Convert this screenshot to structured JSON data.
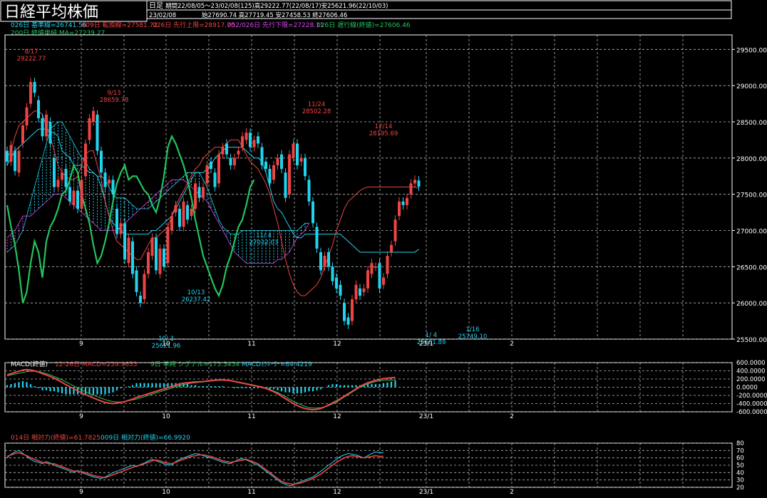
{
  "header": {
    "title": "日経平均株価",
    "period_type": "日足",
    "period_info": "期間22/08/05～23/02/08(125)高29222.77(22/08/17)安25621.96(22/10/03)",
    "date": "23/02/08",
    "ohlc": "始27690.74 高27719.45 安27458.53 終27606.46"
  },
  "legend_line1": [
    {
      "text": "026日 基準線=26741.56",
      "color": "#22d3ee"
    },
    {
      "text": "009日 転換線=27581.72",
      "color": "#ef4444"
    },
    {
      "text": "026日 先行上限=28917.70",
      "color": "#ef4444"
    },
    {
      "text": "052/026日 先行下限=27228.11",
      "color": "#d946ef"
    },
    {
      "text": "026日 遅行線(終値)=27606.46",
      "color": "#22c55e"
    }
  ],
  "legend_line2": [
    {
      "text": "200日 終値単純 MA=27239.27",
      "color": "#22c55e"
    }
  ],
  "macd_legend": [
    {
      "text": "MACD(終値)",
      "color": "#ffffff"
    },
    {
      "text": "12-26日 MACD=239.9653",
      "color": "#ef4444"
    },
    {
      "text": "9日 単純 シグナル=175.5434",
      "color": "#22c55e"
    },
    {
      "text": "MACDｵｼﾚｰﾀｰ=64.4219",
      "color": "#22d3ee"
    }
  ],
  "rsi_legend": [
    {
      "text": "014日 相対力(終値)=61.7825",
      "color": "#ef4444"
    },
    {
      "text": "009日 相対力(終値)=66.9920",
      "color": "#22d3ee"
    }
  ],
  "month_labels": [
    "9",
    "10",
    "11",
    "12",
    "23/1",
    "2"
  ],
  "colors": {
    "up": "#ef4444",
    "down": "#22d3ee",
    "cloud_a": "#22d3ee",
    "cloud_b": "#d946ef",
    "lagging": "#22c55e",
    "grid": "#bbbbbb"
  },
  "chart_data": [
    {
      "type": "candlestick",
      "ylim": [
        25500,
        29700
      ],
      "yticks": [
        "29500.00",
        "29000.00",
        "28500.00",
        "28000.00",
        "27500.00",
        "27000.00",
        "26500.00",
        "26000.00",
        "25500.00"
      ],
      "annotations": [
        {
          "label": "8/17",
          "value": "29222.77",
          "color": "#ef4444"
        },
        {
          "label": "9/13",
          "value": "28659.78",
          "color": "#ef4444"
        },
        {
          "label": "10/ 3",
          "value": "25621.96",
          "color": "#22d3ee"
        },
        {
          "label": "10/13",
          "value": "26237.42",
          "color": "#22d3ee"
        },
        {
          "label": "11/ 4",
          "value": "27032.03",
          "color": "#22d3ee"
        },
        {
          "label": "11/24",
          "value": "28502.28",
          "color": "#ef4444"
        },
        {
          "label": "12/14",
          "value": "28195.69",
          "color": "#ef4444"
        },
        {
          "label": "1/ 4",
          "value": "25661.89",
          "color": "#22d3ee"
        },
        {
          "label": "1/16",
          "value": "25749.10",
          "color": "#22d3ee"
        }
      ],
      "closes": [
        27950,
        28180,
        27820,
        28100,
        28450,
        28700,
        29050,
        28900,
        28550,
        28300,
        28600,
        28200,
        27600,
        27700,
        27800,
        27600,
        27400,
        27550,
        27300,
        27700,
        28200,
        28550,
        28650,
        28100,
        27800,
        27600,
        27700,
        27500,
        26950,
        27100,
        26600,
        26900,
        26400,
        26150,
        26000,
        26400,
        26700,
        26900,
        26450,
        26750,
        26500,
        27050,
        27200,
        27350,
        27050,
        27400,
        27150,
        27300,
        27650,
        27450,
        27600,
        27900,
        27850,
        27600,
        28050,
        28150,
        28050,
        27900,
        28000,
        28100,
        28300,
        28350,
        28150,
        28250,
        28200,
        27900,
        27850,
        27650,
        27900,
        28000,
        27850,
        27450,
        28050,
        28200,
        27900,
        28000,
        27750,
        27400,
        27100,
        26750,
        26450,
        26650,
        26500,
        26300,
        26200,
        26100,
        25750,
        25700,
        26050,
        26250,
        26100,
        26200,
        26450,
        26550,
        26500,
        26200,
        26350,
        26650,
        26800,
        27150,
        27400,
        27350,
        27450,
        27650,
        27700,
        27606
      ],
      "opens": [
        28100,
        27950,
        28100,
        27800,
        28200,
        28450,
        28750,
        29050,
        28800,
        28550,
        28300,
        28500,
        28000,
        27600,
        27700,
        27850,
        27600,
        27350,
        27550,
        27300,
        27750,
        28250,
        28500,
        28600,
        28100,
        27800,
        27650,
        27700,
        27300,
        26950,
        27100,
        26550,
        26850,
        26450,
        26100,
        26050,
        26400,
        26650,
        26900,
        26400,
        26750,
        26550,
        27000,
        27250,
        27300,
        27050,
        27350,
        27200,
        27300,
        27600,
        27450,
        27650,
        27950,
        27800,
        27650,
        28050,
        28200,
        28000,
        27900,
        28050,
        28150,
        28250,
        28350,
        28150,
        28300,
        28150,
        27950,
        27850,
        27700,
        27900,
        28050,
        27800,
        27500,
        28000,
        28200,
        27950,
        28000,
        27700,
        27400,
        27050,
        26700,
        26500,
        26700,
        26500,
        26350,
        26250,
        26000,
        25800,
        25750,
        26050,
        26200,
        26150,
        26200,
        26400,
        26500,
        26550,
        26250,
        26400,
        26700,
        26850,
        27200,
        27400,
        27350,
        27500,
        27650,
        27690
      ],
      "kijun": [
        27900,
        28000,
        28100,
        28150,
        28200,
        28250,
        28300,
        28350,
        28400,
        28400,
        28400,
        28350,
        28350,
        28300,
        28100,
        28050,
        28000,
        27900,
        27900,
        27900,
        27850,
        27800,
        27800,
        27750,
        27600,
        27400,
        27200,
        27100,
        27050,
        27000,
        26950,
        26950,
        26950,
        26950,
        26950,
        26950,
        26950,
        27000,
        27000,
        27050,
        27100,
        27150,
        27200,
        27300,
        27400,
        27500,
        27600,
        27700,
        27800,
        27800,
        27800,
        27850,
        27900,
        28000,
        28050,
        28100,
        28150,
        28150,
        28150,
        28150,
        28150,
        28100,
        28050,
        28000,
        28000,
        27950,
        27800,
        27600,
        27400,
        27300,
        27250,
        27150,
        27050,
        26950,
        26900,
        26900,
        26950,
        26950,
        26950,
        26950,
        26950,
        26950,
        26950,
        26950,
        26950,
        26950,
        26900,
        26850,
        26800,
        26750,
        26700,
        26700,
        26700,
        26700,
        26700,
        26700,
        26700,
        26700,
        26700,
        26700,
        26700,
        26700,
        26700,
        26700,
        26700,
        26742
      ],
      "tenkan": [
        28000,
        28100,
        28300,
        28450,
        28500,
        28550,
        28600,
        28650,
        28650,
        28600,
        28450,
        28300,
        28100,
        27900,
        27800,
        27750,
        27700,
        27700,
        27750,
        27900,
        28050,
        28100,
        28100,
        27900,
        27700,
        27400,
        27200,
        27000,
        26850,
        26800,
        26750,
        26700,
        26650,
        26600,
        26600,
        26700,
        26800,
        26900,
        26900,
        26950,
        27000,
        27050,
        27200,
        27350,
        27450,
        27550,
        27650,
        27750,
        27850,
        27900,
        28000,
        28050,
        28100,
        28150,
        28150,
        28150,
        28200,
        28250,
        28250,
        28250,
        28150,
        28050,
        27950,
        27900,
        27850,
        27750,
        27650,
        27500,
        27300,
        27100,
        26850,
        26600,
        26400,
        26250,
        26150,
        26100,
        26100,
        26150,
        26200,
        26250,
        26350,
        26500,
        26650,
        26800,
        27000,
        27150,
        27300,
        27400,
        27450,
        27500,
        27550,
        27582,
        27600,
        27600,
        27600,
        27600,
        27600,
        27600,
        27600,
        27600,
        27600,
        27600,
        27600,
        27600,
        27600,
        27582
      ],
      "lagging": [
        27350,
        27050,
        26800,
        26450,
        26000,
        26150,
        26550,
        26850,
        26700,
        26350,
        26850,
        27050,
        27150,
        27300,
        27500,
        27550,
        27700,
        27900,
        27800,
        27500,
        27300,
        27100,
        26800,
        26550,
        26650,
        26850,
        27100,
        27400,
        27650,
        27800,
        27900,
        27700,
        27750,
        27750,
        27650,
        27550,
        27500,
        27350,
        27250,
        27450,
        27750,
        28150,
        28300,
        28200,
        28050,
        27900,
        27700,
        27450,
        27150,
        26900,
        26650,
        26500,
        26350,
        26200,
        26100,
        26250,
        26500,
        26650,
        26850,
        27050,
        27150,
        27350,
        27600,
        27700
      ],
      "cloud_a": [
        26700,
        26750,
        26800,
        26900,
        27000,
        27200,
        27400,
        27600,
        27800,
        28000,
        28200,
        28400,
        28450,
        28500,
        28500,
        28400,
        28300,
        28200,
        28100,
        28000,
        27950,
        27850,
        27800,
        27750,
        27750,
        27700,
        27600,
        27500,
        27450,
        27450,
        27450,
        27400,
        27350,
        27300,
        27300,
        27300,
        27300,
        27350,
        27400,
        27450,
        27500,
        27550,
        27600,
        27650,
        27700,
        27750,
        27800,
        27800,
        27800,
        27800,
        27700,
        27600,
        27450,
        27300,
        27150,
        27050,
        27000,
        26950,
        26950,
        26950,
        27000,
        27000,
        27000,
        27000,
        27000,
        27000,
        27000,
        27000,
        27000,
        27000,
        27000,
        27000,
        27000,
        27000,
        27000,
        27050,
        27100,
        27100
      ],
      "cloud_b": [
        26900,
        26950,
        27000,
        27100,
        27200,
        27200,
        27200,
        27250,
        27300,
        27350,
        27400,
        27450,
        27500,
        27500,
        27500,
        27450,
        27400,
        27350,
        27300,
        27250,
        27200,
        27150,
        27100,
        27050,
        27000,
        27000,
        27000,
        27000,
        27000,
        27050,
        27100,
        27150,
        27200,
        27250,
        27300,
        27350,
        27400,
        27450,
        27500,
        27550,
        27600,
        27650,
        27700,
        27700,
        27700,
        27700,
        27650,
        27600,
        27550,
        27500,
        27450,
        27400,
        27300,
        27200,
        27100,
        27000,
        26900,
        26800,
        26700,
        26650,
        26600,
        26550,
        26550,
        26550,
        26550,
        26550,
        26550,
        26550,
        26550,
        26600,
        26600,
        26650,
        26700,
        26800,
        26900,
        26950,
        27000,
        27100
      ]
    },
    {
      "type": "line",
      "name": "MACD",
      "ylim": [
        -600000,
        600000
      ],
      "yticks": [
        "600.0000",
        "400.0000",
        "200.0000",
        "0.0000",
        "-200.0000",
        "-400.0000",
        "-600.0000"
      ],
      "macd": [
        300,
        330,
        360,
        390,
        420,
        430,
        420,
        400,
        370,
        330,
        300,
        260,
        220,
        170,
        120,
        60,
        10,
        -40,
        -90,
        -140,
        -180,
        -220,
        -260,
        -300,
        -340,
        -370,
        -390,
        -400,
        -390,
        -370,
        -350,
        -320,
        -290,
        -250,
        -220,
        -190,
        -160,
        -130,
        -100,
        -70,
        -40,
        -10,
        20,
        50,
        80,
        100,
        110,
        120,
        130,
        130,
        140,
        150,
        160,
        170,
        180,
        180,
        170,
        160,
        140,
        120,
        100,
        80,
        60,
        40,
        20,
        0,
        -30,
        -70,
        -110,
        -160,
        -220,
        -280,
        -340,
        -400,
        -450,
        -490,
        -520,
        -540,
        -550,
        -540,
        -520,
        -480,
        -430,
        -380,
        -330,
        -280,
        -220,
        -160,
        -100,
        -40,
        20,
        70,
        110,
        140,
        170,
        190,
        210,
        220,
        230,
        240
      ],
      "signal": [
        280,
        300,
        320,
        340,
        360,
        380,
        390,
        390,
        380,
        360,
        330,
        300,
        260,
        220,
        180,
        130,
        80,
        30,
        -20,
        -70,
        -110,
        -150,
        -190,
        -230,
        -270,
        -300,
        -330,
        -350,
        -360,
        -360,
        -350,
        -330,
        -310,
        -290,
        -260,
        -230,
        -200,
        -170,
        -140,
        -110,
        -80,
        -50,
        -20,
        10,
        40,
        60,
        80,
        100,
        110,
        120,
        130,
        140,
        150,
        160,
        170,
        170,
        170,
        160,
        150,
        130,
        110,
        90,
        70,
        50,
        30,
        10,
        -20,
        -50,
        -90,
        -130,
        -180,
        -230,
        -290,
        -340,
        -390,
        -430,
        -470,
        -500,
        -510,
        -510,
        -500,
        -480,
        -450,
        -410,
        -360,
        -300,
        -240,
        -180,
        -120,
        -60,
        0,
        40,
        80,
        110,
        140,
        160,
        170,
        175,
        176,
        176
      ]
    },
    {
      "type": "line",
      "name": "RSI",
      "ylim": [
        20,
        80
      ],
      "yticks": [
        "80",
        "70",
        "60",
        "50",
        "40",
        "30",
        "20"
      ],
      "rsi14": [
        62,
        64,
        66,
        67,
        65,
        63,
        60,
        58,
        56,
        54,
        53,
        52,
        52,
        50,
        48,
        46,
        44,
        42,
        42,
        41,
        40,
        38,
        36,
        35,
        34,
        33,
        35,
        37,
        39,
        41,
        43,
        45,
        47,
        49,
        50,
        52,
        54,
        56,
        57,
        56,
        54,
        53,
        52,
        54,
        56,
        58,
        60,
        62,
        63,
        64,
        64,
        63,
        62,
        60,
        58,
        56,
        55,
        54,
        55,
        56,
        57,
        58,
        56,
        54,
        52,
        48,
        44,
        40,
        36,
        32,
        28,
        26,
        25,
        24,
        25,
        26,
        28,
        30,
        32,
        35,
        38,
        42,
        46,
        50,
        54,
        57,
        60,
        62,
        63,
        62,
        61,
        60,
        61,
        62,
        63,
        62,
        62
      ],
      "rsi9": [
        60,
        65,
        68,
        70,
        66,
        62,
        58,
        55,
        54,
        52,
        55,
        53,
        50,
        48,
        46,
        44,
        42,
        40,
        43,
        40,
        38,
        36,
        34,
        33,
        32,
        34,
        37,
        40,
        42,
        44,
        46,
        48,
        50,
        48,
        51,
        53,
        56,
        58,
        56,
        54,
        52,
        51,
        50,
        55,
        58,
        60,
        62,
        64,
        66,
        65,
        63,
        61,
        60,
        58,
        56,
        54,
        53,
        52,
        55,
        58,
        59,
        57,
        55,
        52,
        50,
        46,
        42,
        38,
        34,
        30,
        26,
        24,
        22,
        23,
        26,
        28,
        30,
        32,
        34,
        38,
        42,
        46,
        50,
        54,
        58,
        62,
        64,
        66,
        65,
        64,
        62,
        60,
        63,
        66,
        68,
        67,
        67
      ]
    }
  ]
}
